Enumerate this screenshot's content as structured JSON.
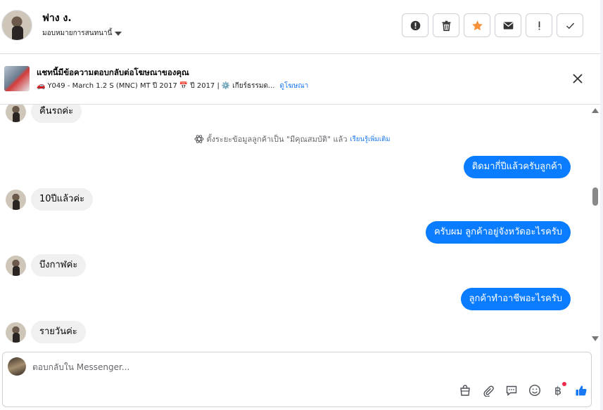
{
  "header": {
    "contact_name": "ฟาง ง.",
    "assign_label": "มอบหมายการสนทนานี้",
    "actions": [
      {
        "name": "mark-spam-button",
        "icon": "alert-circle-icon"
      },
      {
        "name": "delete-button",
        "icon": "trash-icon"
      },
      {
        "name": "star-button",
        "icon": "star-icon"
      },
      {
        "name": "mark-unread-button",
        "icon": "envelope-icon"
      },
      {
        "name": "follow-up-button",
        "icon": "exclamation-icon"
      },
      {
        "name": "mark-done-button",
        "icon": "checkmark-icon"
      }
    ],
    "star_color": "#f7923b"
  },
  "ad": {
    "title": "แชทนี้มีข้อความตอบกลับต่อโฆษณาของคุณ",
    "car_emoji": "🚗",
    "details": "Y049 - March 1.2 S (MNC) MT ปี 2017",
    "calendar_emoji": "📅",
    "year": "ปี 2017 |",
    "gear_emoji": "⚙️",
    "transmission": "เกียร์ธรรมด...",
    "view_ad_link": "ดูโฆษณา"
  },
  "messages": [
    {
      "direction": "in",
      "text": "คืนรถค่ะ"
    },
    {
      "direction": "system",
      "text": "ตั้งระยะข้อมูลลูกค้าเป็น \"มีคุณสมบัติ\" แล้ว",
      "link": "เรียนรู้เพิ่มเติม"
    },
    {
      "direction": "out",
      "text": "ติดมากี่ปีแล้วครับลูกค้า"
    },
    {
      "direction": "in",
      "text": "10ปีแล้วค่ะ"
    },
    {
      "direction": "out",
      "text": "ครับผม ลูกค้าอยู่จังหวัดอะไรครับ"
    },
    {
      "direction": "in",
      "text": "บึงกาฬค่ะ"
    },
    {
      "direction": "out",
      "text": "ลูกค้าทำอาชีพอะไรครับ"
    },
    {
      "direction": "in",
      "text": "รายวันค่ะ"
    }
  ],
  "composer": {
    "placeholder": "ตอบกลับใน Messenger...",
    "tools": [
      "shopping-bag-icon",
      "paperclip-icon",
      "saved-reply-icon",
      "emoji-icon",
      "baht-payment-icon",
      "thumbs-up-icon"
    ],
    "baht_symbol": "฿"
  },
  "colors": {
    "outgoing_bubble": "#0a7cff",
    "incoming_bubble": "#f0f0f0",
    "link": "#1877f2",
    "like": "#1877f2"
  }
}
